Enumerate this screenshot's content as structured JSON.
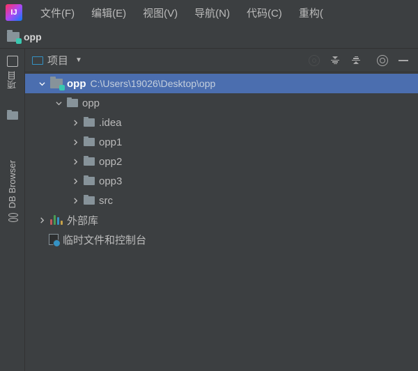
{
  "app_icon_text": "IJ",
  "menu": {
    "file": "文件(F)",
    "edit": "编辑(E)",
    "view": "视图(V)",
    "nav": "导航(N)",
    "code": "代码(C)",
    "refactor": "重构("
  },
  "breadcrumb": {
    "project": "opp"
  },
  "left_rail": {
    "project": "项目",
    "db": "DB Browser"
  },
  "panel_header": {
    "title": "项目"
  },
  "tree": {
    "root": {
      "name": "opp",
      "path": "C:\\Users\\19026\\Desktop\\opp"
    },
    "level2": {
      "name": "opp"
    },
    "children": [
      {
        "name": ".idea"
      },
      {
        "name": "opp1"
      },
      {
        "name": "opp2"
      },
      {
        "name": "opp3"
      },
      {
        "name": "src"
      }
    ],
    "ext_libs": "外部库",
    "scratches": "临时文件和控制台"
  }
}
